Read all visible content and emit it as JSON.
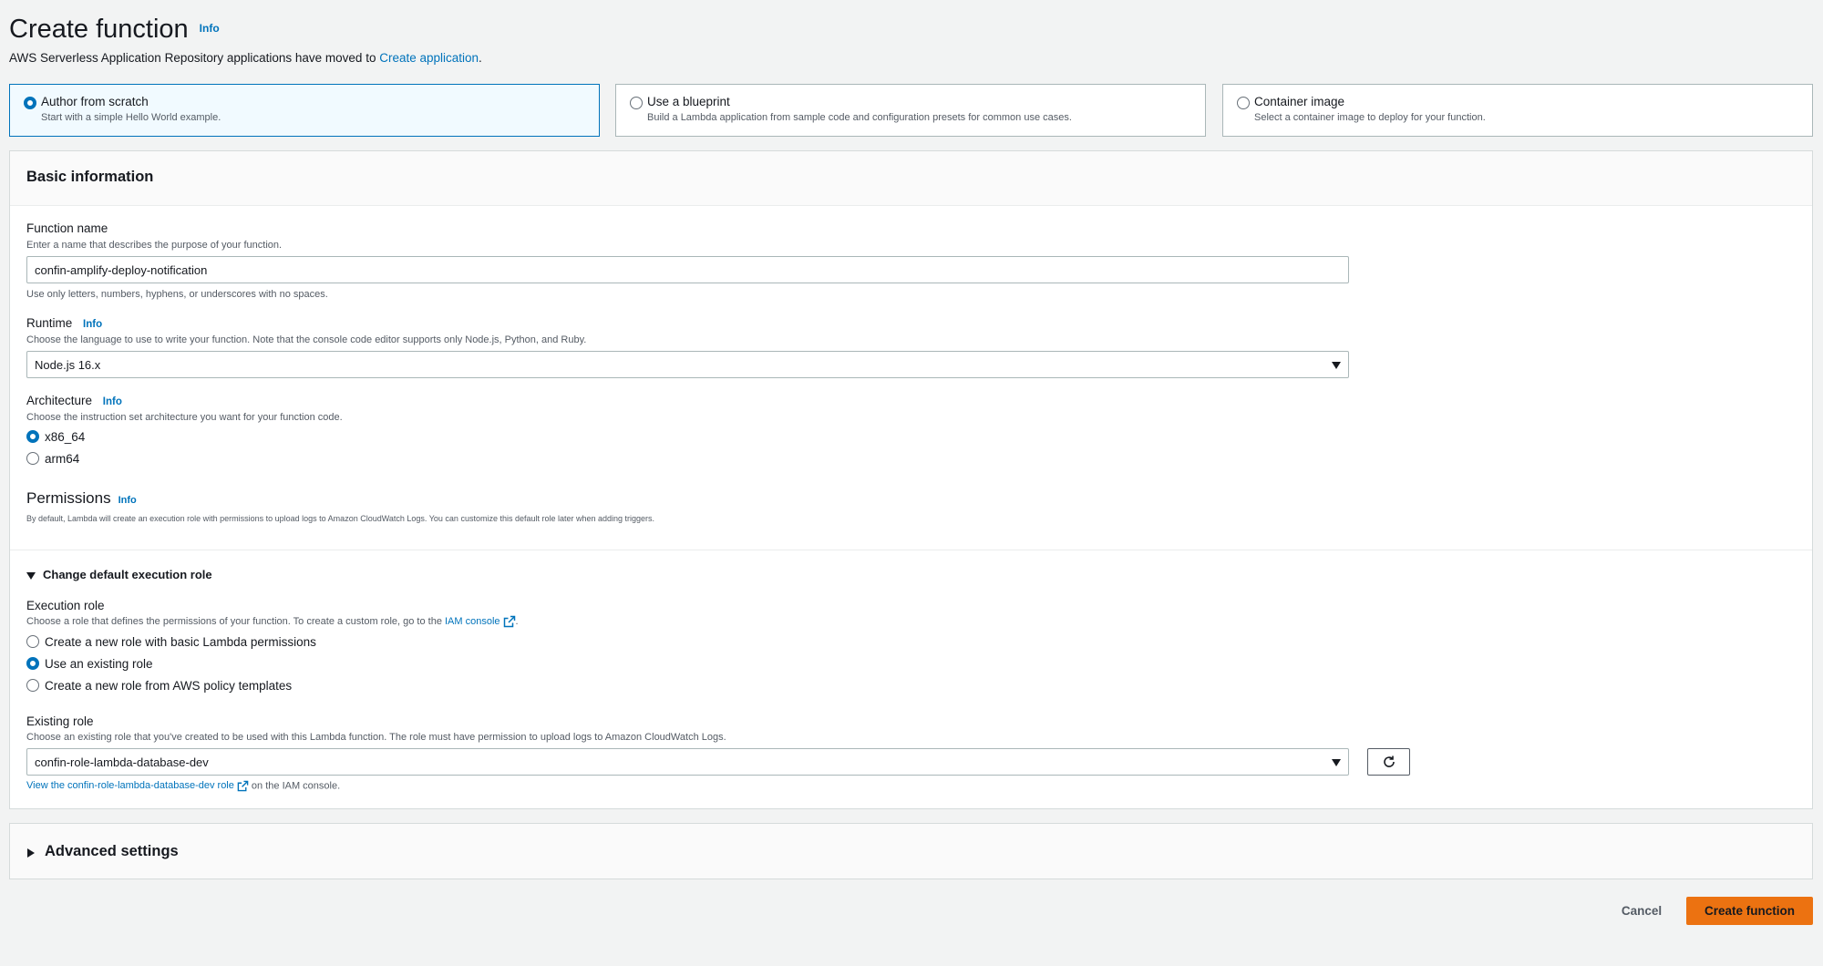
{
  "header": {
    "title": "Create function",
    "info": "Info",
    "subtitle_prefix": "AWS Serverless Application Repository applications have moved to ",
    "subtitle_link": "Create application",
    "subtitle_suffix": "."
  },
  "options": [
    {
      "title": "Author from scratch",
      "desc": "Start with a simple Hello World example.",
      "selected": true
    },
    {
      "title": "Use a blueprint",
      "desc": "Build a Lambda application from sample code and configuration presets for common use cases.",
      "selected": false
    },
    {
      "title": "Container image",
      "desc": "Select a container image to deploy for your function.",
      "selected": false
    }
  ],
  "basic": {
    "heading": "Basic information",
    "function_name": {
      "label": "Function name",
      "desc": "Enter a name that describes the purpose of your function.",
      "value": "confin-amplify-deploy-notification",
      "hint": "Use only letters, numbers, hyphens, or underscores with no spaces."
    },
    "runtime": {
      "label": "Runtime",
      "info": "Info",
      "desc": "Choose the language to use to write your function. Note that the console code editor supports only Node.js, Python, and Ruby.",
      "value": "Node.js 16.x"
    },
    "architecture": {
      "label": "Architecture",
      "info": "Info",
      "desc": "Choose the instruction set architecture you want for your function code.",
      "options": [
        "x86_64",
        "arm64"
      ],
      "selected": "x86_64"
    },
    "permissions": {
      "title": "Permissions",
      "info": "Info",
      "desc": "By default, Lambda will create an execution role with permissions to upload logs to Amazon CloudWatch Logs. You can customize this default role later when adding triggers."
    },
    "execution_toggle": "Change default execution role",
    "execution_role": {
      "label": "Execution role",
      "desc_prefix": "Choose a role that defines the permissions of your function. To create a custom role, go to the ",
      "desc_link": "IAM console",
      "desc_suffix": ".",
      "options": [
        "Create a new role with basic Lambda permissions",
        "Use an existing role",
        "Create a new role from AWS policy templates"
      ],
      "selected": "Use an existing role"
    },
    "existing_role": {
      "label": "Existing role",
      "desc": "Choose an existing role that you've created to be used with this Lambda function. The role must have permission to upload logs to Amazon CloudWatch Logs.",
      "value": "confin-role-lambda-database-dev",
      "view_link": "View the confin-role-lambda-database-dev role",
      "view_suffix": " on the IAM console."
    }
  },
  "advanced": {
    "title": "Advanced settings"
  },
  "actions": {
    "cancel": "Cancel",
    "create": "Create function"
  },
  "colors": {
    "accent": "#0073bb",
    "primary_button": "#ec7211",
    "background": "#f2f3f3"
  }
}
